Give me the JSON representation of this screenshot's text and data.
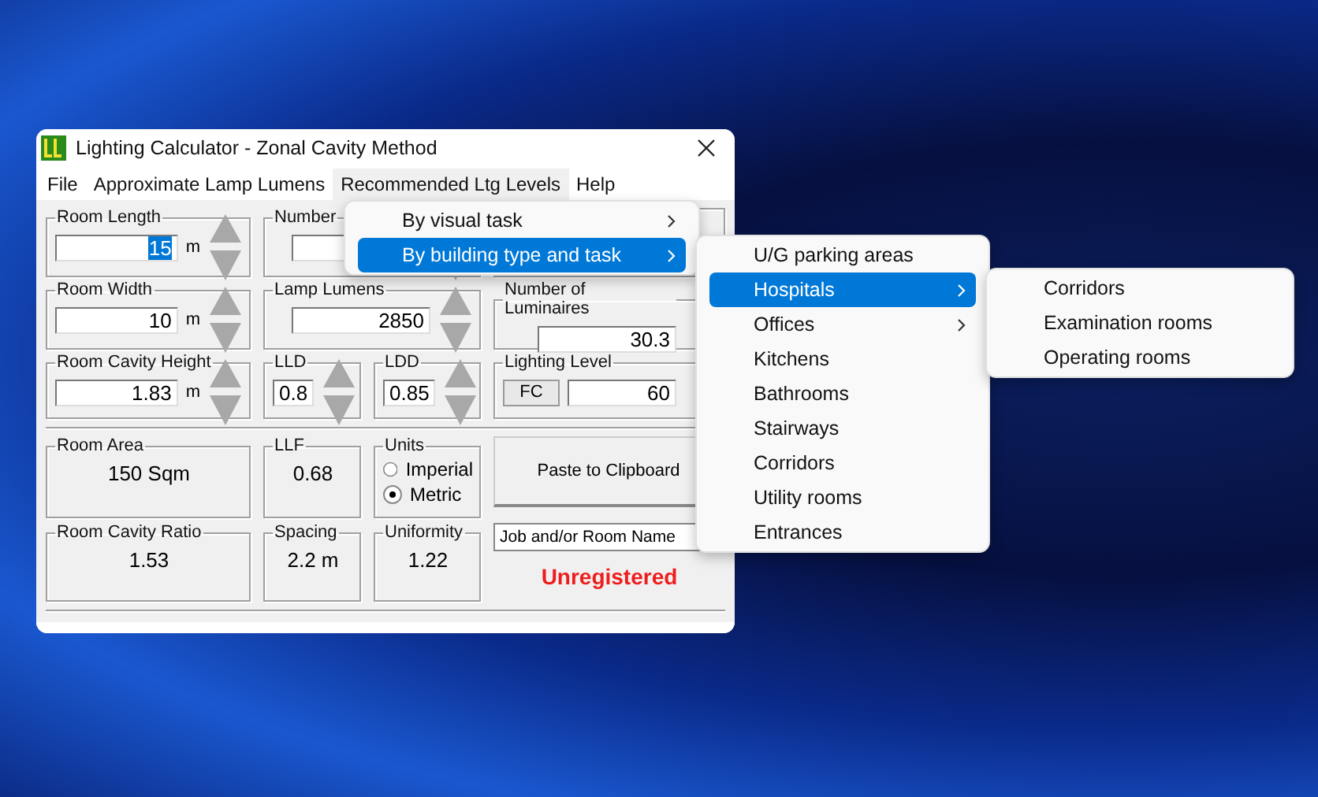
{
  "window": {
    "title": "Lighting Calculator - Zonal Cavity Method"
  },
  "menu_bar": [
    {
      "label": "File",
      "selected": false
    },
    {
      "label": "Approximate Lamp Lumens",
      "selected": false
    },
    {
      "label": "Recommended Ltg Levels",
      "selected": true
    },
    {
      "label": "Help",
      "selected": false
    }
  ],
  "room_length": {
    "label": "Room Length",
    "value": "15",
    "unit": "m",
    "highlighted": true
  },
  "number_of": {
    "label": "Number"
  },
  "room_width": {
    "label": "Room Width",
    "value": "10",
    "unit": "m",
    "highlighted": false
  },
  "lamp_lumens": {
    "label": "Lamp Lumens",
    "value": "2850"
  },
  "number_of_luminaires": {
    "label": "Number of Luminaires",
    "value": "30.3"
  },
  "room_cavity_height": {
    "label": "Room Cavity Height",
    "value": "1.83",
    "unit": "m",
    "highlighted": false
  },
  "lld": {
    "label": "LLD",
    "value": "0.8"
  },
  "ldd": {
    "label": "LDD",
    "value": "0.85"
  },
  "lighting_level": {
    "label": "Lighting Level",
    "unit_button": "FC",
    "value": "60"
  },
  "room_area": {
    "label": "Room Area",
    "value": "150 Sqm"
  },
  "llf": {
    "label": "LLF",
    "value": "0.68"
  },
  "units": {
    "label": "Units",
    "options": [
      {
        "label": "Imperial",
        "selected": false
      },
      {
        "label": "Metric",
        "selected": true
      }
    ]
  },
  "paste_button": "Paste to Clipboard",
  "room_cavity_ratio": {
    "label": "Room Cavity Ratio",
    "value": "1.53"
  },
  "spacing": {
    "label": "Spacing",
    "value": "2.2 m"
  },
  "uniformity": {
    "label": "Uniformity",
    "value": "1.22"
  },
  "job_name": {
    "value": "Job and/or Room Name"
  },
  "status": "Unregistered",
  "menus": [
    {
      "items": [
        {
          "label": "By visual task",
          "has_submenu": true,
          "selected": false
        },
        {
          "label": "By building type and task",
          "has_submenu": true,
          "selected": true
        }
      ]
    },
    {
      "items": [
        {
          "label": "U/G parking areas",
          "has_submenu": false,
          "selected": false
        },
        {
          "label": "Hospitals",
          "has_submenu": true,
          "selected": true
        },
        {
          "label": "Offices",
          "has_submenu": true,
          "selected": false
        },
        {
          "label": "Kitchens",
          "has_submenu": false,
          "selected": false
        },
        {
          "label": "Bathrooms",
          "has_submenu": false,
          "selected": false
        },
        {
          "label": "Stairways",
          "has_submenu": false,
          "selected": false
        },
        {
          "label": "Corridors",
          "has_submenu": false,
          "selected": false
        },
        {
          "label": "Utility rooms",
          "has_submenu": false,
          "selected": false
        },
        {
          "label": "Entrances",
          "has_submenu": false,
          "selected": false
        }
      ]
    },
    {
      "items": [
        {
          "label": "Corridors",
          "has_submenu": false,
          "selected": false
        },
        {
          "label": "Examination rooms",
          "has_submenu": false,
          "selected": false
        },
        {
          "label": "Operating rooms",
          "has_submenu": false,
          "selected": false
        }
      ]
    }
  ]
}
